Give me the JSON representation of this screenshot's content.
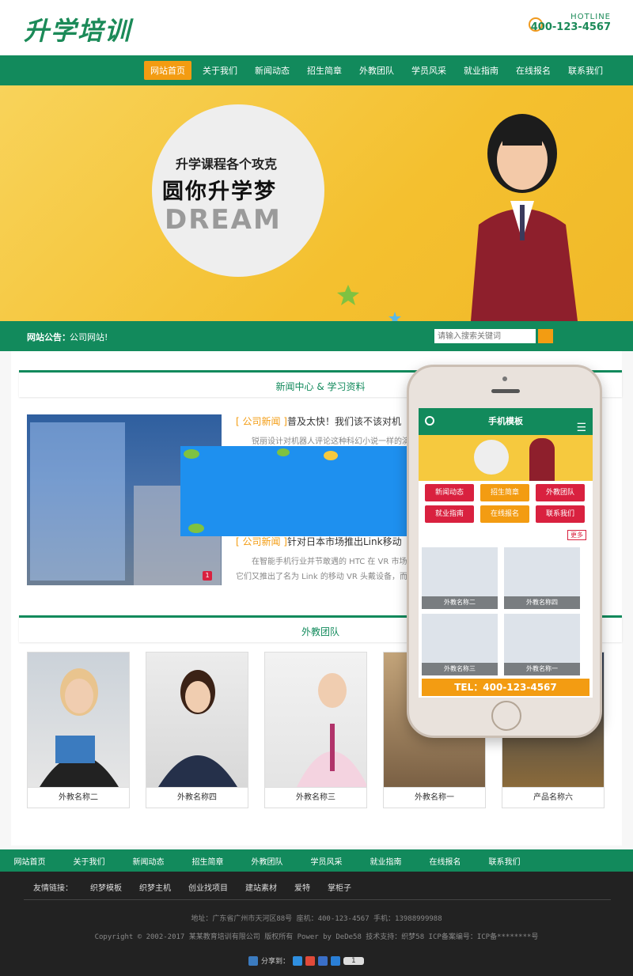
{
  "header": {
    "logo": "升学培训",
    "hotline_label": "HOTLINE",
    "hotline_number": "400-123-4567"
  },
  "nav": [
    "网站首页",
    "关于我们",
    "新闻动态",
    "招生简章",
    "外教团队",
    "学员风采",
    "就业指南",
    "在线报名",
    "联系我们"
  ],
  "banner": {
    "subtitle": "升学课程各个攻克",
    "title": "圆你升学梦",
    "dream": "DREAM"
  },
  "notice": {
    "label": "网站公告：",
    "text": "公司网站!",
    "search_placeholder": "请输入搜索关键词"
  },
  "news_section": {
    "title": "新闻中心 & 学习资料",
    "items": [
      {
        "category": "[ 公司新闻 ]",
        "title": "普及太快！我们该不该对机",
        "desc": "锐丽设计对机器人评论这种科幻小说一样的演讲来"
      },
      {
        "category": "[ 公司新闻 ]",
        "title": "针对日本市场推出Link移动",
        "desc": "在智能手机行业并节敢遇的 HTC 在 VR 市场混的"
      }
    ],
    "extra_desc": "它们又推出了名为 Link 的移动 VR 头戴设备，而在一",
    "image_badge": "1"
  },
  "team_section": {
    "title": "外教团队",
    "cards": [
      "外教名称二",
      "外教名称四",
      "外教名称三",
      "外教名称一",
      "产品名称六"
    ]
  },
  "mobile": {
    "title": "手机模板",
    "buttons": [
      "新闻动态",
      "招生简章",
      "外教团队",
      "就业指南",
      "在线报名",
      "联系我们"
    ],
    "more": "更多",
    "cells": [
      "外教名称二",
      "外教名称四",
      "外教名称三",
      "外教名称一"
    ],
    "tel": "TEL：400-123-4567"
  },
  "footer_nav": [
    "网站首页",
    "关于我们",
    "新闻动态",
    "招生简章",
    "外教团队",
    "学员风采",
    "就业指南",
    "在线报名",
    "联系我们"
  ],
  "footer": {
    "links_label": "友情链接：",
    "links": [
      "织梦模板",
      "织梦主机",
      "创业找项目",
      "建站素材",
      "爱特",
      "掌柜子"
    ],
    "address": "地址：广东省广州市天河区88号        座机：400-123-4567        手机：13988999988",
    "copyright": "Copyright © 2002-2017 某某教育培训有限公司 版权所有 Power by DeDe58        技术支持：织梦58        ICP备案编号：ICP备********号",
    "share_label": "分享到：",
    "share_count": "1"
  },
  "colors": {
    "primary_green": "#128a5c",
    "accent_orange": "#f39c12",
    "mobile_red": "#d9213f"
  }
}
